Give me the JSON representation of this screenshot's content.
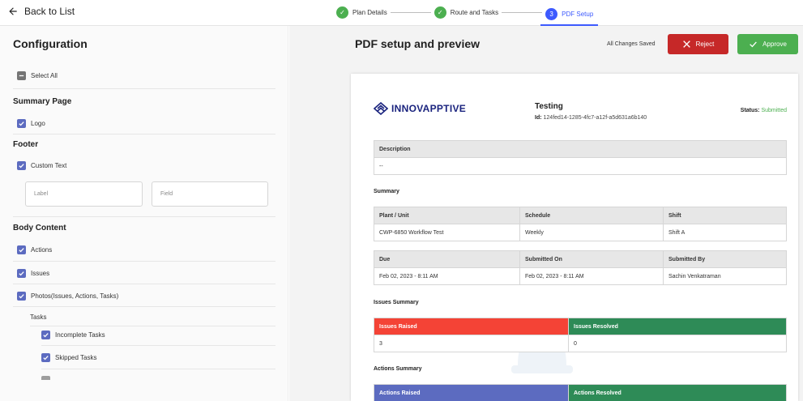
{
  "topbar": {
    "back_label": "Back to List"
  },
  "stepper": [
    {
      "label": "Plan Details",
      "state": "done",
      "marker": "✓"
    },
    {
      "label": "Route and Tasks",
      "state": "done",
      "marker": "✓"
    },
    {
      "label": "PDF Setup",
      "state": "active",
      "marker": "3"
    }
  ],
  "config": {
    "title": "Configuration",
    "select_all": "Select All",
    "summary_page": {
      "heading": "Summary Page",
      "logo": "Logo"
    },
    "footer": {
      "heading": "Footer",
      "custom_text": "Custom Text",
      "label_placeholder": "Label",
      "field_placeholder": "Field"
    },
    "body": {
      "heading": "Body Content",
      "actions": "Actions",
      "issues": "Issues",
      "photos": "Photos(Issues, Actions, Tasks)",
      "tasks_heading": "Tasks",
      "incomplete": "Incomplete Tasks",
      "skipped": "Skipped Tasks"
    }
  },
  "preview": {
    "title": "PDF setup and preview",
    "saved_text": "All Changes Saved",
    "reject_label": "Reject",
    "approve_label": "Approve",
    "logo_text": "INNOVAPPTIVE",
    "doc_name": "Testing",
    "id_label": "Id:",
    "id_value": "124fed14-1285-4fc7-a12f-a5d631a6b140",
    "status_label": "Status:",
    "status_value": "Submitted",
    "description_header": "Description",
    "description_value": "--",
    "summary_heading": "Summary",
    "summary_headers": [
      "Plant / Unit",
      "Schedule",
      "Shift"
    ],
    "summary_values": [
      "CWP-6850 Workflow Test",
      "Weekly",
      "Shift A"
    ],
    "due_headers": [
      "Due",
      "Submitted On",
      "Submitted By"
    ],
    "due_values": [
      "Feb 02, 2023 - 8:11 AM",
      "Feb 02, 2023 - 8:11 AM",
      "Sachin Venkatraman"
    ],
    "issues_heading": "Issues Summary",
    "issues_headers": [
      "Issues Raised",
      "Issues Resolved"
    ],
    "issues_values": [
      "3",
      "0"
    ],
    "actions_heading": "Actions Summary",
    "actions_headers": [
      "Actions Raised",
      "Actions Resolved"
    ]
  },
  "colors": {
    "accent": "#3d5afe",
    "checkbox": "#5c6bc0",
    "reject": "#c62828",
    "approve": "#4caf50",
    "issues_raised": "#f44336",
    "issues_resolved": "#2e8b57",
    "actions_raised": "#5c6bc0",
    "actions_resolved": "#2e8b57"
  }
}
